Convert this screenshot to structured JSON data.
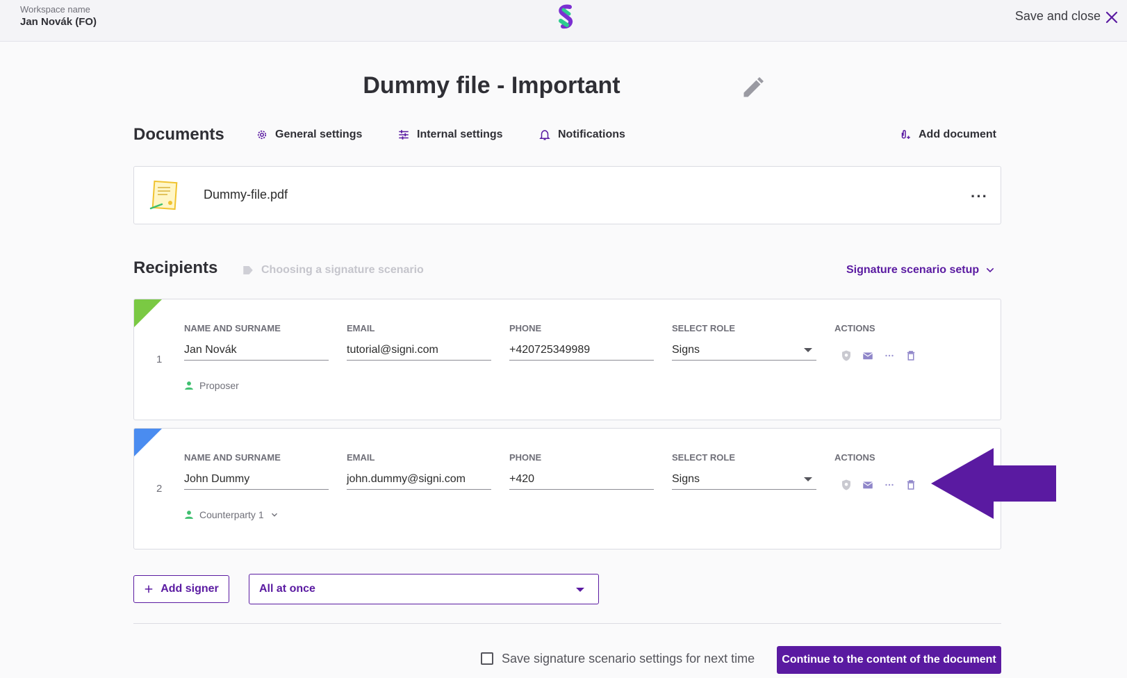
{
  "header": {
    "workspace_label": "Workspace name",
    "workspace_name": "Jan Novák (FO)",
    "save_close_label": "Save and close",
    "logo_icon": "signi-logo-icon",
    "close_icon": "close-icon"
  },
  "document_title": "Dummy file - Important",
  "documents": {
    "heading": "Documents",
    "general_settings": "General settings",
    "internal_settings": "Internal settings",
    "notifications": "Notifications",
    "add_document": "Add document",
    "file_name": "Dummy-file.pdf",
    "more_label": "···"
  },
  "recipients": {
    "heading": "Recipients",
    "scenario_hint": "Choosing a signature scenario",
    "scenario_setup": "Signature scenario setup",
    "columns": {
      "name": "NAME AND SURNAME",
      "email": "EMAIL",
      "phone": "PHONE",
      "role": "SELECT ROLE",
      "actions": "ACTIONS"
    },
    "list": [
      {
        "index": "1",
        "name": "Jan Novák",
        "email": "tutorial@signi.com",
        "phone": "+420725349989",
        "role": "Signs",
        "party": "Proposer",
        "corner_color": "#7ac943"
      },
      {
        "index": "2",
        "name": "John Dummy",
        "email": "john.dummy@signi.com",
        "phone": "+420",
        "role": "Signs",
        "party": "Counterparty 1",
        "corner_color": "#4a8cf0"
      }
    ]
  },
  "footer": {
    "add_signer": "Add signer",
    "order_mode": "All at once",
    "save_scenario": "Save signature scenario settings for next time",
    "continue": "Continue to the content of the document"
  },
  "colors": {
    "accent": "#5a1aa1",
    "annotation_arrow": "#5a1aa1"
  }
}
